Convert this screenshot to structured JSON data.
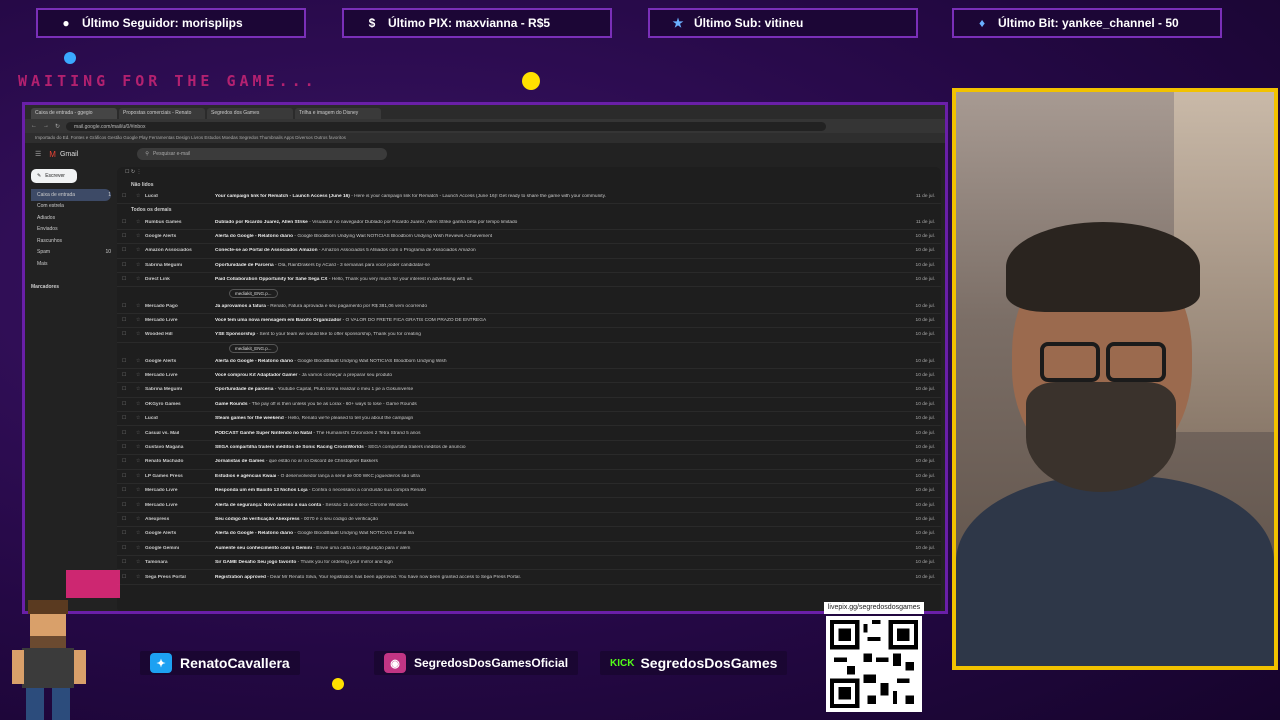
{
  "overlay": {
    "alerts": [
      {
        "icon": "user-icon",
        "text": "Último Seguidor: morisplips"
      },
      {
        "icon": "dollar-icon",
        "text": "Último PIX: maxvianna - R$5"
      },
      {
        "icon": "star-icon",
        "text": "Último Sub: vitineu"
      },
      {
        "icon": "diamond-icon",
        "text": "Último Bit: yankee_channel - 50"
      }
    ],
    "waiting": "WAITING FOR THE GAME...",
    "social": {
      "twitter": "RenatoCavallera",
      "instagram": "SegredosDosGamesOficial",
      "kick_tag": "KICK",
      "kick": "SegredosDosGames"
    },
    "qr_caption": "livepix.gg/segredosdosgames"
  },
  "browser": {
    "tabs": [
      "Caixa de entrada - ggegio",
      "Propostas comerciais - Renato",
      "Segredos dos Games",
      "Trilha e imagem do Disney"
    ],
    "url": "mail.google.com/mail/u/0/#inbox",
    "bookmarks": "Importado do Ed.  Fontes e Gráficos  Gestão  Google Play  Ferramentas  Design  Livros  Estudos  Moedas  Segredos  Thumbnails  Apps  Diversos  Outros favoritos"
  },
  "gmail": {
    "logo": "Gmail",
    "search_placeholder": "Pesquisar e-mail",
    "compose": "Escrever",
    "nav": [
      {
        "label": "Caixa de entrada",
        "count": "1"
      },
      {
        "label": "Com estrela",
        "count": ""
      },
      {
        "label": "Adiados",
        "count": ""
      },
      {
        "label": "Enviados",
        "count": ""
      },
      {
        "label": "Rascunhos",
        "count": ""
      },
      {
        "label": "Spam",
        "count": "10"
      },
      {
        "label": "Mais",
        "count": ""
      }
    ],
    "labels_title": "Marcadores",
    "sec_unread": "Não lidos",
    "sec_all": "Todos os demais",
    "unread": [
      {
        "sender": "Lucid",
        "subject": "Your campaign link for Rematch - Launch Access (June 16)",
        "snippet": " - Here is your campaign link for Rematch - Launch Access (June 16)! Get ready to share the game with your community.",
        "date": "11 de jul."
      }
    ],
    "rows": [
      {
        "sender": "Rumbus Games",
        "subject": "Dublado por Ricardo Juarez, Allen Strike",
        "snippet": " - Visualizar no navegador Dublado por Ricardo Juarez, Allen Strike ganha beta por tempo limitado",
        "date": "11 de jul."
      },
      {
        "sender": "Google Alerts",
        "subject": "Alerta do Google - Relatório diário",
        "snippet": " - Google Bloodborn Undying Wait NOTÍCIAS Bloodborn Undying Wish Reviews Achievement",
        "date": "10 de jul."
      },
      {
        "sender": "Amazon Associados",
        "subject": "Conecte-se ao Portal de Associados Amazon",
        "snippet": " - Amazon Associados 5 Afiliados com o Programa de Associados Amazon",
        "date": "10 de jul."
      },
      {
        "sender": "Sabrina Megumi",
        "subject": "Oportunidade de Parceria",
        "snippet": " - Olá, RainDrakers by ACard - 3 semanas para você poder candidatar-se",
        "date": "10 de jul."
      },
      {
        "sender": "Direct Link",
        "subject": "Paid Collaboration Opportunity for Sahe Sega CX",
        "snippet": " - Hello, Thank you very much for your interest in advertising with us.",
        "date": "10 de jul.",
        "attachment": "mediakit_ENG.p..."
      },
      {
        "sender": "Mercado Pago",
        "subject": "Já aprovamos a fatura",
        "snippet": " - Renato, Fatura aprovada e seu pagamento por R$ 381,06 vem ocorrendo",
        "date": "10 de jul."
      },
      {
        "sender": "Mercado Livre",
        "subject": "Você tem uma nova mensagem em Baixito Organizador",
        "snippet": " - O VALOR DO FRETE FICA GRÁTIS COM PRAZO DE ENTREGA",
        "date": "10 de jul."
      },
      {
        "sender": "Wooded Hill",
        "subject": "YSE Sponsorship",
        "snippet": " - Sent to your team we would like to offer sponsorship, Thank you for creating",
        "date": "10 de jul.",
        "attachment": "mediakit_ENG.p..."
      },
      {
        "sender": "Google Alerts",
        "subject": "Alerta do Google - Relatório diário",
        "snippet": " - Google BloodBlaatt Undying Wait NOTÍCIAS Bloodborn Undying Wish",
        "date": "10 de jul."
      },
      {
        "sender": "Mercado Livre",
        "subject": "Você comprou Kit Adaptador Gamer",
        "snippet": " - Já vamos começar a preparar seu produto",
        "date": "10 de jul."
      },
      {
        "sender": "Sabrina Megumi",
        "subject": "Oportunidade de parceria",
        "snippet": " - Youtube Capital, Pluto forma realizar o meu 1 pe a Gokuniverse",
        "date": "10 de jul."
      },
      {
        "sender": "OKGyro Games",
        "subject": "Game Rounds",
        "snippet": " - The pay off is then unless you tie as Lorax - 60+ ways to lose - Game Rounds",
        "date": "10 de jul."
      },
      {
        "sender": "Lucid",
        "subject": "Steam games for the weekend",
        "snippet": " - Hello, Renato we're pleased to tell you about the campaign",
        "date": "10 de jul."
      },
      {
        "sender": "Casual vs. Mail",
        "subject": "PODCAST Ganhe Super Nintendo no Natal",
        "snippet": " - The Humanist's Chronicles 2 Tetra Strand 5 anos",
        "date": "10 de jul."
      },
      {
        "sender": "Gustavo Magana",
        "subject": "SEGA compartilha trailers inéditos de Sonic Racing CrossWorlds",
        "snippet": " - SEGA compartilha trailers inéditos de anúncio",
        "date": "10 de jul."
      },
      {
        "sender": "Renato Machado",
        "subject": "Jornalistas de Games",
        "snippet": " - que estão no ar no Discord de Christopher Bakkers",
        "date": "10 de jul."
      },
      {
        "sender": "LP Games Press",
        "subject": "Estúdios e agências Kwaai",
        "snippet": " - O desenvolvedor lança a série de 000 WKC joguedeiros são ultra",
        "date": "10 de jul."
      },
      {
        "sender": "Mercado Livre",
        "subject": "Responda um em Baixito 13 Nichos Loja",
        "snippet": " - Confira o necessário a conclusão sua compra Renato",
        "date": "10 de jul."
      },
      {
        "sender": "Mercado Livre",
        "subject": "Alerta de segurança: Novo acesso à sua conta",
        "snippet": " - Sessão 15 acontece Chrome Windows",
        "date": "10 de jul."
      },
      {
        "sender": "Aliexpress",
        "subject": "Seu código de verificação Aliexpress",
        "snippet": " - 0070 é o seu código de verificação",
        "date": "10 de jul."
      },
      {
        "sender": "Google Alerts",
        "subject": "Alerta do Google - Relatório diário",
        "snippet": " - Google BloodBlaatt Undying Wait NOTÍCIAS Cheat fila",
        "date": "10 de jul."
      },
      {
        "sender": "Google Gemini",
        "subject": "Aumente seu conhecimento com o Gemini",
        "snippet": " - Envie uma carta a configuração para ir além",
        "date": "10 de jul."
      },
      {
        "sender": "Tamonara",
        "subject": "Sir GAME Desafio Seu jogo favorito",
        "snippet": " - Thank you for ordering your mirror and sign",
        "date": "10 de jul."
      },
      {
        "sender": "Sega Press Portal",
        "subject": "Registration approved",
        "snippet": " - Dear Mr Renato Silva, Your registration has been approved. You have now been granted access to Sega Press Portal.",
        "date": "10 de jul."
      }
    ]
  },
  "colors": {
    "frame": "#6a1fa8",
    "cam_border": "#f2c200",
    "waiting": "#e0287a"
  }
}
